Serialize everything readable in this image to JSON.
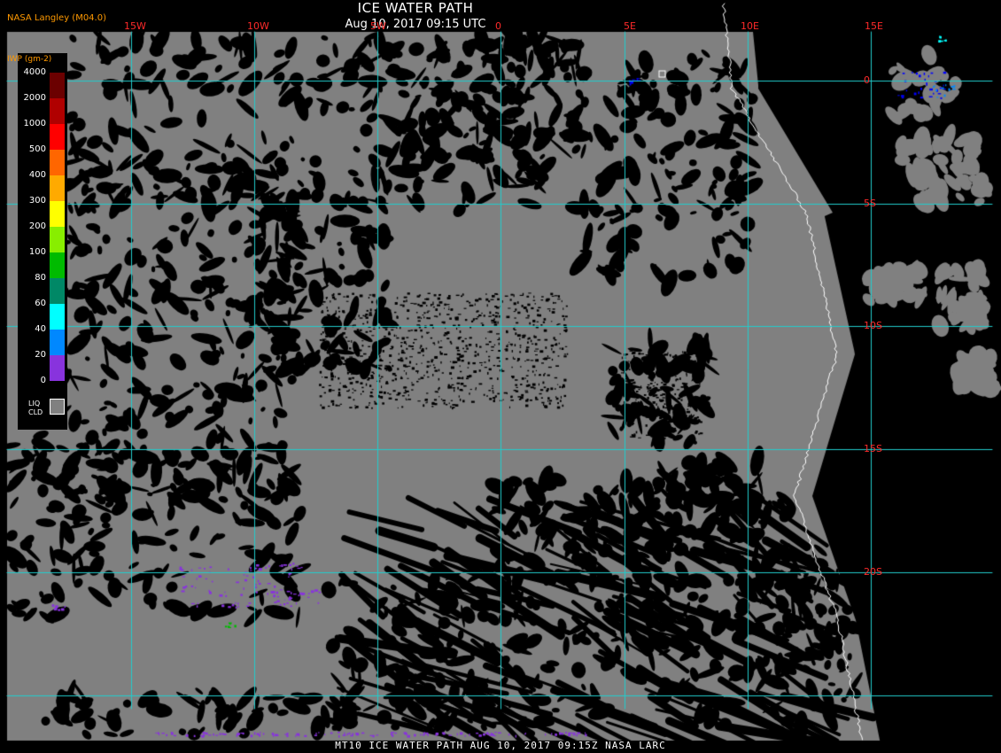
{
  "header": {
    "title": "ICE WATER PATH",
    "datetime": "Aug 10, 2017 09:15 UTC",
    "brand": "NASA Langley (M04.0)"
  },
  "grid": {
    "longitude_labels": [
      "15W",
      "10W",
      "5W",
      "0",
      "5E",
      "10E",
      "15E"
    ],
    "latitude_labels": [
      "0",
      "5S",
      "10S",
      "15S",
      "20S"
    ]
  },
  "legend": {
    "units": "IWP (gm-2)",
    "values": [
      "4000",
      "2000",
      "1000",
      "500",
      "400",
      "300",
      "200",
      "100",
      "80",
      "60",
      "40",
      "20",
      "0"
    ],
    "colors": [
      "#6b0000",
      "#b00000",
      "#ff0000",
      "#ff6600",
      "#ffaa00",
      "#ffff00",
      "#88ee00",
      "#00bb00",
      "#008866",
      "#00ffff",
      "#0088ff",
      "#0000ff",
      "#8833dd"
    ],
    "liq_label": "LIQ\nCLD",
    "liq_color": "#808080"
  },
  "footer": {
    "text": "MT10  ICE WATER PATH  AUG 10, 2017 09:15Z  NASA LARC"
  },
  "colors": {
    "ocean_clear": "#000000",
    "liquid_cloud": "#808080",
    "grid": "#22cccc",
    "label": "#ff2a2a",
    "coast": "#ffffff"
  }
}
